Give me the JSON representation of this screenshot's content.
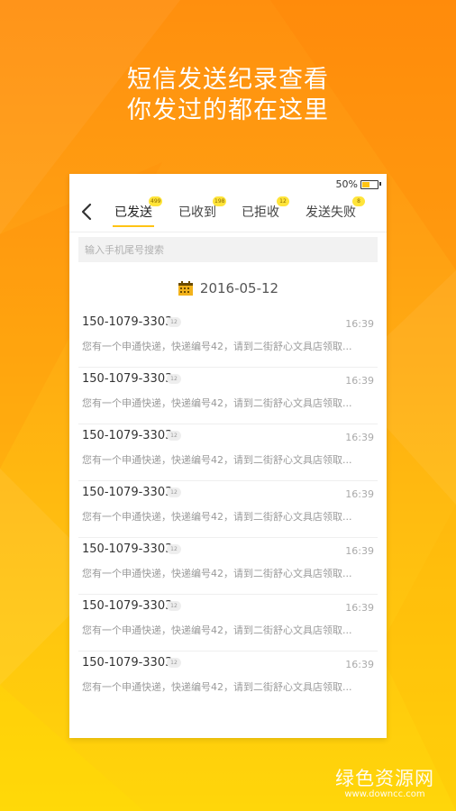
{
  "headline": {
    "line1": "短信发送纪录查看",
    "line2": "你发过的都在这里"
  },
  "status_bar": {
    "battery_text": "50%",
    "battery_level": 0.5
  },
  "tabs": [
    {
      "label": "已发送",
      "badge": "499",
      "active": true
    },
    {
      "label": "已收到",
      "badge": "198",
      "active": false
    },
    {
      "label": "已拒收",
      "badge": "12",
      "active": false
    },
    {
      "label": "发送失败",
      "badge": "8",
      "active": false
    }
  ],
  "search": {
    "placeholder": "输入手机尾号搜索",
    "value": ""
  },
  "date_header": {
    "date": "2016-05-12",
    "icon": "calendar-icon"
  },
  "messages": [
    {
      "phone": "150-1079-3303",
      "count": "12",
      "time": "16:39",
      "preview": "您有一个申通快递，快递编号42，请到二街舒心文具店领取..."
    },
    {
      "phone": "150-1079-3303",
      "count": "12",
      "time": "16:39",
      "preview": "您有一个申通快递，快递编号42，请到二街舒心文具店领取..."
    },
    {
      "phone": "150-1079-3303",
      "count": "12",
      "time": "16:39",
      "preview": "您有一个申通快递，快递编号42，请到二街舒心文具店领取..."
    },
    {
      "phone": "150-1079-3303",
      "count": "12",
      "time": "16:39",
      "preview": "您有一个申通快递，快递编号42，请到二街舒心文具店领取..."
    },
    {
      "phone": "150-1079-3303",
      "count": "12",
      "time": "16:39",
      "preview": "您有一个申通快递，快递编号42，请到二街舒心文具店领取..."
    },
    {
      "phone": "150-1079-3303",
      "count": "12",
      "time": "16:39",
      "preview": "您有一个申通快递，快递编号42，请到二街舒心文具店领取..."
    },
    {
      "phone": "150-1079-3303",
      "count": "12",
      "time": "16:39",
      "preview": "您有一个申通快递，快递编号42，请到二街舒心文具店领取..."
    }
  ],
  "watermark": {
    "name": "绿色资源网",
    "url": "www.downcc.com"
  },
  "colors": {
    "accent": "#ffc414",
    "badge": "#ffe43a",
    "bg_top": "#ff8f0e",
    "bg_bottom": "#ffd60a"
  }
}
